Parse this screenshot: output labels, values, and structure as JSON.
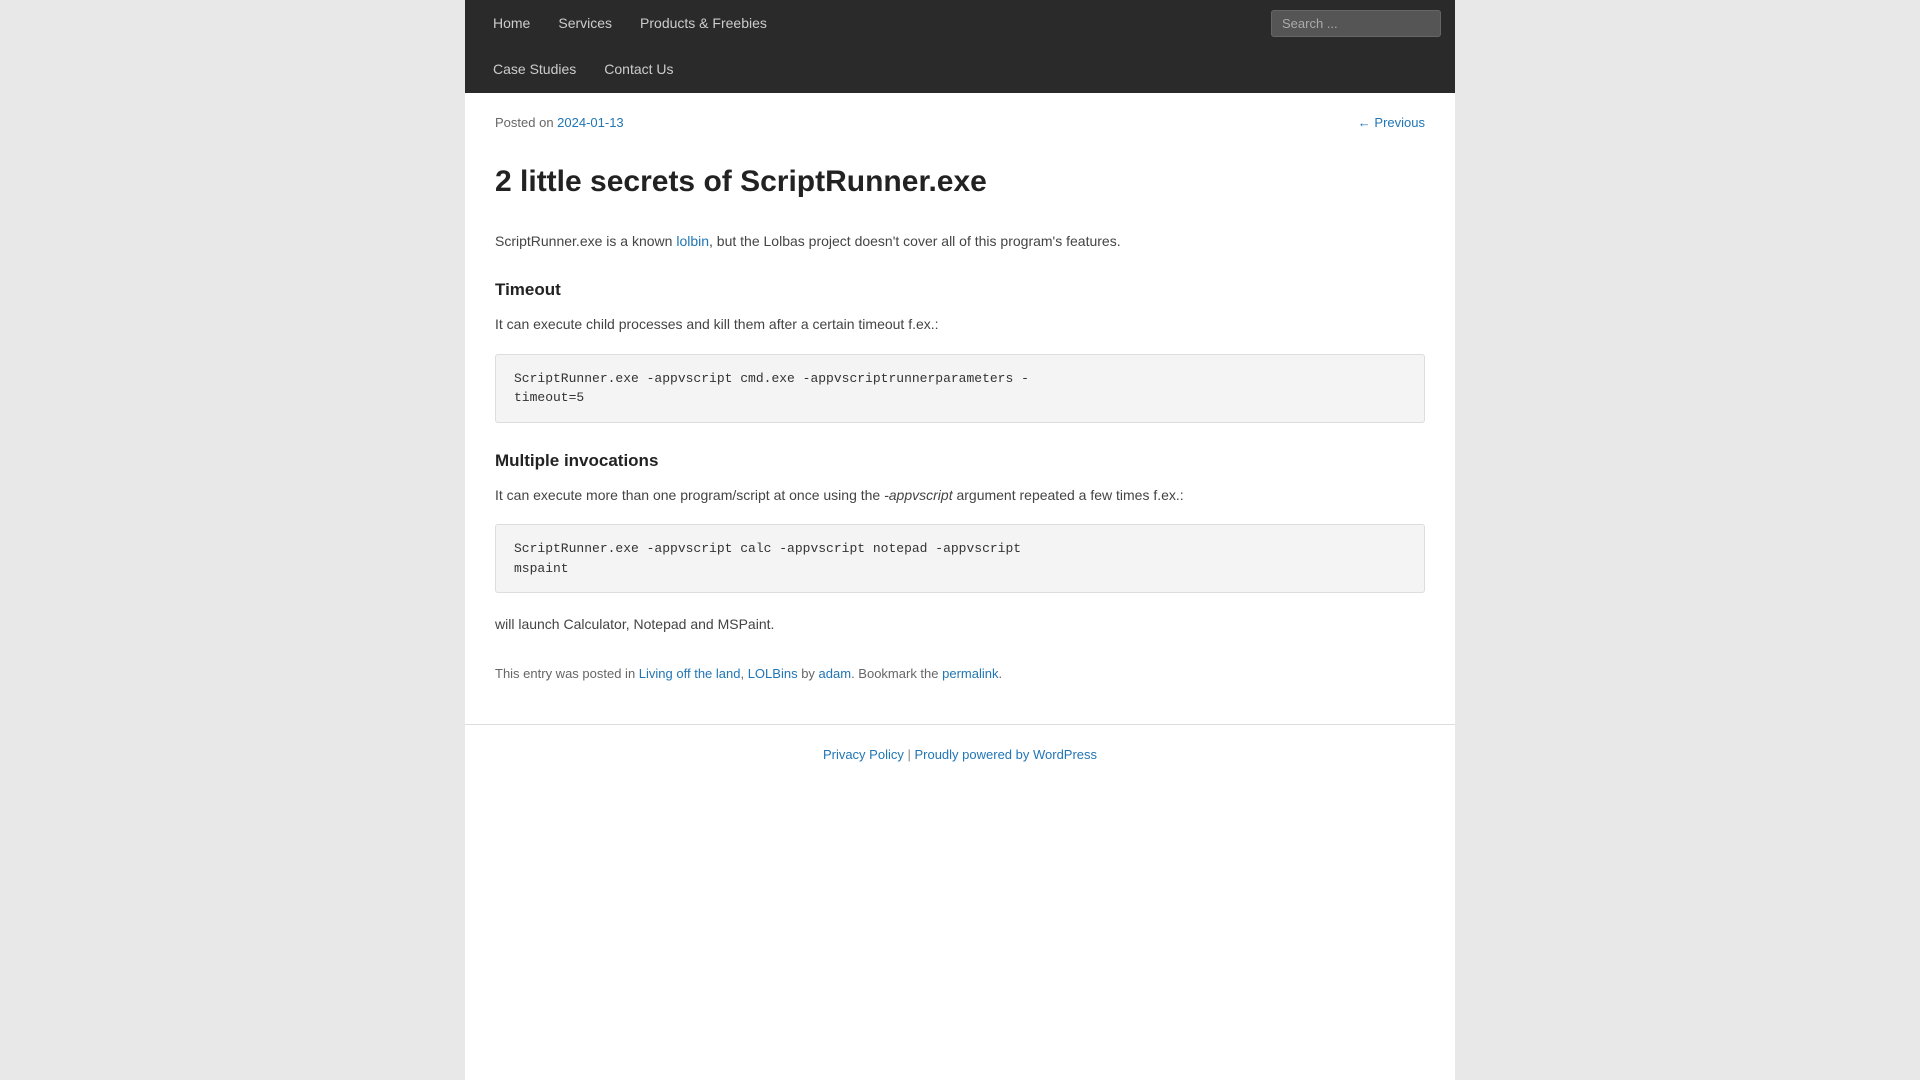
{
  "nav": {
    "items_row1": [
      {
        "label": "Home",
        "href": "#"
      },
      {
        "label": "Services",
        "href": "#"
      },
      {
        "label": "Products & Freebies",
        "href": "#"
      }
    ],
    "items_row2": [
      {
        "label": "Case Studies",
        "href": "#"
      },
      {
        "label": "Contact Us",
        "href": "#"
      }
    ],
    "search_placeholder": "Search ..."
  },
  "post": {
    "date_display": "2024-01-13",
    "date_href": "#",
    "nav_previous_label": "← Previous",
    "nav_previous_href": "#",
    "title": "2 little secrets of ScriptRunner.exe",
    "intro": "ScriptRunner.exe is a known ",
    "lolbin_text": "lolbin",
    "lolbin_href": "#",
    "intro_rest": ", but the Lolbas project doesn't cover all of this program's features.",
    "section1_heading": "Timeout",
    "section1_body": "It can execute child processes and kill them after a certain timeout f.ex.:",
    "code1": "ScriptRunner.exe -appvscript cmd.exe -appvscriptrunnerparameters -\ntimeout=5",
    "section2_heading": "Multiple invocations",
    "section2_body1": "It can execute more than one program/script at once using the ",
    "section2_italic": "-appvscript",
    "section2_body2": " argument repeated a few times f.ex.:",
    "code2": "ScriptRunner.exe -appvscript calc -appvscript notepad -appvscript\nmspaint",
    "section2_conclusion": "will launch Calculator, Notepad and MSPaint.",
    "footer_prefix": "This entry was posted in ",
    "footer_cat1": "Living off the land",
    "footer_cat1_href": "#",
    "footer_cat_sep": ", ",
    "footer_cat2": "LOLBins",
    "footer_cat2_href": "#",
    "footer_by": " by ",
    "footer_author": "adam",
    "footer_author_href": "#",
    "footer_bookmark": ". Bookmark the ",
    "footer_permalink": "permalink",
    "footer_permalink_href": "#",
    "footer_end": "."
  },
  "site_footer": {
    "privacy_policy": "Privacy Policy",
    "privacy_href": "#",
    "separator": " | ",
    "powered_by": "Proudly powered by WordPress",
    "powered_href": "#"
  }
}
